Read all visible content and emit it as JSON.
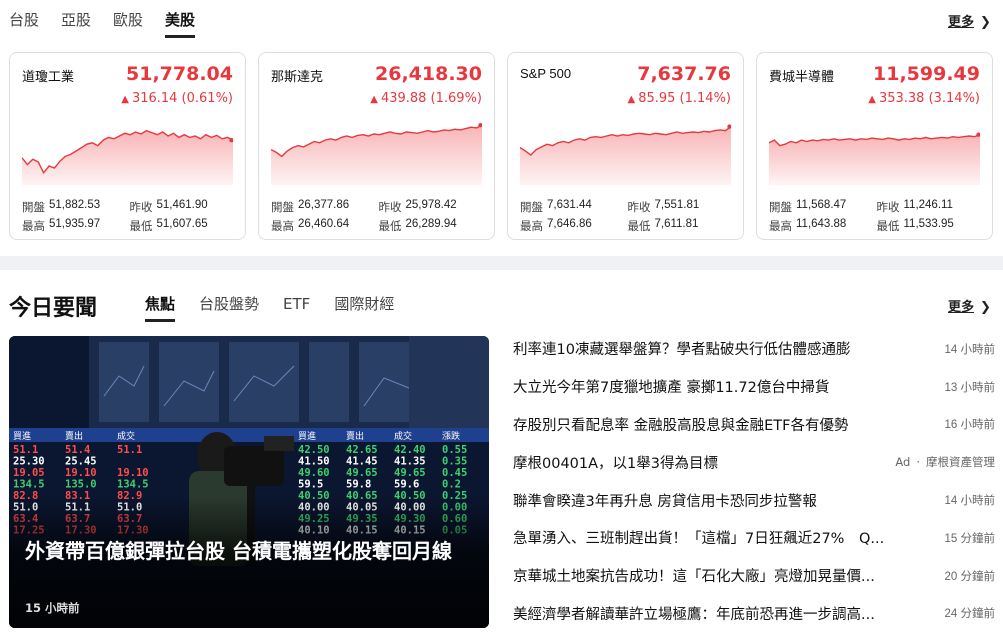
{
  "market": {
    "tabs": [
      "台股",
      "亞股",
      "歐股",
      "美股"
    ],
    "active_tab": "美股",
    "more_label": "更多",
    "colors": {
      "up": "#e8383d",
      "area_fill": "#f8b4b6"
    },
    "cards": [
      {
        "name": "道瓊工業",
        "price": "51,778.04",
        "change": "316.14 (0.61%)",
        "open_label": "開盤",
        "open": "51,882.53",
        "prev_label": "昨收",
        "prev": "51,461.90",
        "high_label": "最高",
        "high": "51,935.97",
        "low_label": "最低",
        "low": "51,607.65",
        "spark": [
          0.4,
          0.3,
          0.38,
          0.34,
          0.18,
          0.28,
          0.25,
          0.35,
          0.42,
          0.45,
          0.5,
          0.55,
          0.6,
          0.62,
          0.58,
          0.66,
          0.7,
          0.68,
          0.72,
          0.76,
          0.74,
          0.78,
          0.75,
          0.8,
          0.77,
          0.74,
          0.78,
          0.72,
          0.76,
          0.7,
          0.74,
          0.7,
          0.72,
          0.68,
          0.74,
          0.7,
          0.73,
          0.68,
          0.7,
          0.66
        ]
      },
      {
        "name": "那斯達克",
        "price": "26,418.30",
        "change": "439.88 (1.69%)",
        "open_label": "開盤",
        "open": "26,377.86",
        "prev_label": "昨收",
        "prev": "25,978.42",
        "high_label": "最高",
        "high": "26,460.64",
        "low_label": "最低",
        "low": "26,289.94",
        "spark": [
          0.52,
          0.48,
          0.42,
          0.5,
          0.55,
          0.58,
          0.56,
          0.6,
          0.64,
          0.62,
          0.66,
          0.68,
          0.66,
          0.7,
          0.72,
          0.7,
          0.73,
          0.74,
          0.72,
          0.75,
          0.74,
          0.76,
          0.78,
          0.76,
          0.75,
          0.78,
          0.77,
          0.76,
          0.78,
          0.8,
          0.78,
          0.79,
          0.81,
          0.8,
          0.82,
          0.81,
          0.83,
          0.85,
          0.84,
          0.88
        ]
      },
      {
        "name": "S&P 500",
        "price": "7,637.76",
        "change": "85.95 (1.14%)",
        "open_label": "開盤",
        "open": "7,631.44",
        "prev_label": "昨收",
        "prev": "7,551.81",
        "high_label": "最高",
        "high": "7,646.86",
        "low_label": "最低",
        "low": "7,611.81",
        "spark": [
          0.55,
          0.5,
          0.44,
          0.52,
          0.56,
          0.6,
          0.58,
          0.62,
          0.64,
          0.62,
          0.66,
          0.68,
          0.66,
          0.7,
          0.71,
          0.7,
          0.72,
          0.74,
          0.72,
          0.74,
          0.73,
          0.75,
          0.76,
          0.75,
          0.74,
          0.76,
          0.75,
          0.74,
          0.76,
          0.78,
          0.76,
          0.77,
          0.78,
          0.77,
          0.79,
          0.78,
          0.8,
          0.81,
          0.8,
          0.86
        ]
      },
      {
        "name": "費城半導體",
        "price": "11,599.49",
        "change": "353.38 (3.14%)",
        "open_label": "開盤",
        "open": "11,568.47",
        "prev_label": "昨收",
        "prev": "11,246.11",
        "high_label": "最高",
        "high": "11,643.88",
        "low_label": "最低",
        "low": "11,533.95",
        "spark": [
          0.62,
          0.66,
          0.58,
          0.6,
          0.64,
          0.62,
          0.66,
          0.64,
          0.66,
          0.65,
          0.67,
          0.66,
          0.68,
          0.66,
          0.67,
          0.68,
          0.66,
          0.68,
          0.67,
          0.69,
          0.68,
          0.67,
          0.69,
          0.68,
          0.66,
          0.68,
          0.67,
          0.69,
          0.68,
          0.7,
          0.68,
          0.69,
          0.7,
          0.69,
          0.71,
          0.7,
          0.71,
          0.72,
          0.71,
          0.74
        ]
      }
    ]
  },
  "news": {
    "title": "今日要聞",
    "tabs": [
      "焦點",
      "台股盤勢",
      "ETF",
      "國際財經"
    ],
    "active_tab": "焦點",
    "more_label": "更多",
    "hero": {
      "board_rows": [
        [
          "51.1",
          "51.4",
          "51.1"
        ],
        [
          "25.30",
          "25.45",
          ""
        ],
        [
          "19.05",
          "19.10",
          "19.10"
        ],
        [
          "134.5",
          "135.0",
          "134.5"
        ],
        [
          "82.8",
          "83.1",
          "82.9"
        ],
        [
          "51.0",
          "51.1",
          "51.0"
        ],
        [
          "63.4",
          "63.7",
          "63.7"
        ],
        [
          "17.25",
          "17.30",
          "17.30"
        ]
      ],
      "board_rows_right": [
        [
          "42.50",
          "42.65",
          "42.40",
          "0.55"
        ],
        [
          "41.50",
          "41.45",
          "41.35",
          "0.35"
        ],
        [
          "49.60",
          "49.65",
          "49.65",
          "0.45"
        ],
        [
          "59.5",
          "59.8",
          "59.6",
          "0.2"
        ],
        [
          "40.50",
          "40.65",
          "40.50",
          "0.25"
        ],
        [
          "40.00",
          "40.05",
          "40.00",
          "0.00"
        ],
        [
          "49.25",
          "49.35",
          "49.30",
          "0.60"
        ],
        [
          "40.10",
          "40.15",
          "40.15",
          "0.05"
        ]
      ],
      "board_headers_left": [
        "買進",
        "賣出",
        "成交"
      ],
      "board_headers_right": [
        "買進",
        "賣出",
        "成交",
        "漲跌"
      ],
      "title": "外資帶百億銀彈拉台股 台積電攜塑化股奪回月線",
      "time": "15 小時前"
    },
    "items": [
      {
        "text": "利率連10凍藏選舉盤算？學者點破央行低估體感通膨",
        "time": "14 小時前"
      },
      {
        "text": "大立光今年第7度獵地擴產 豪擲11.72億台中掃貨",
        "time": "13 小時前"
      },
      {
        "text": "存股別只看配息率 金融股高股息與金融ETF各有優勢",
        "time": "16 小時前"
      },
      {
        "text": "摩根00401A，以1舉3得為目標",
        "ad_label": "Ad",
        "sponsor": "摩根資產管理"
      },
      {
        "text": "聯準會睽違3年再升息 房貸信用卡恐同步拉警報",
        "time": "14 小時前"
      },
      {
        "text": "急單湧入、三班制趕出貨！「這檔」7日狂飆近27%　Q...",
        "time": "15 分鐘前"
      },
      {
        "text": "京華城土地案抗告成功！這「石化大廠」亮燈加晃量價...",
        "time": "20 分鐘前"
      },
      {
        "text": "美經濟學者解讀華許立場極鷹：年底前恐再進一步調高...",
        "time": "24 分鐘前"
      }
    ]
  }
}
